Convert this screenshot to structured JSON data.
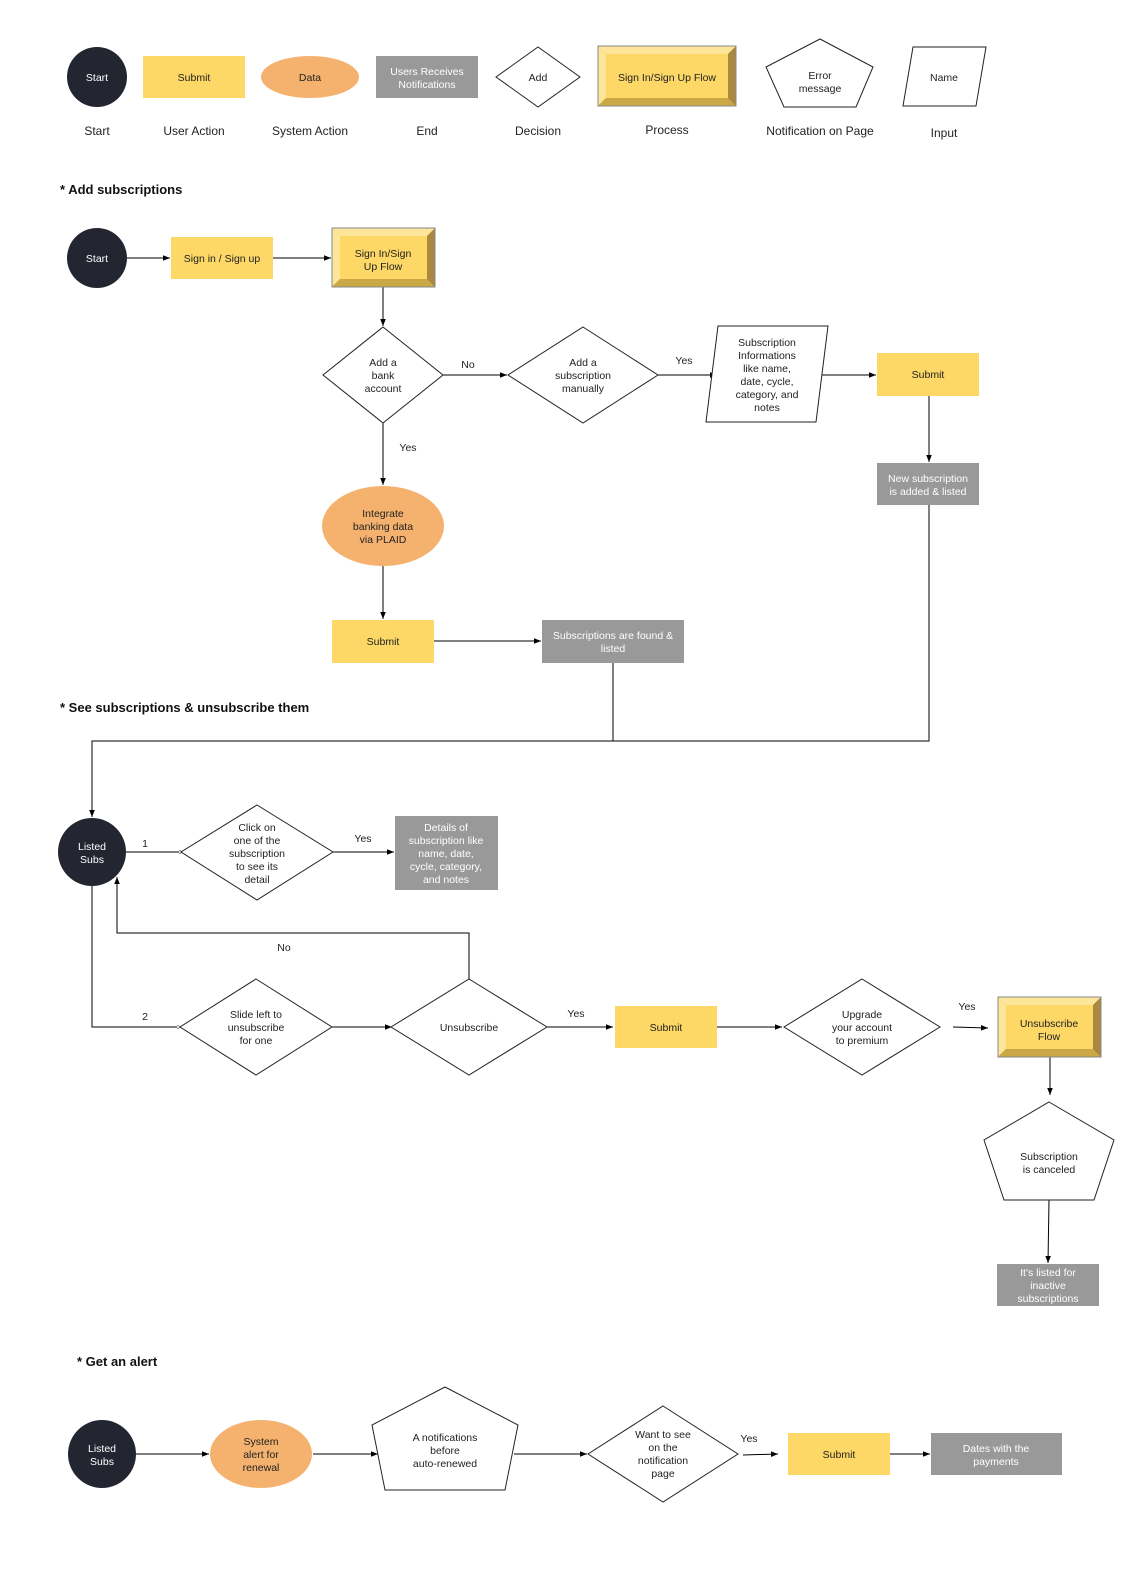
{
  "colors": {
    "start": "#232631",
    "user_action": "#fdd866",
    "system_action": "#f5b26e",
    "end": "#999999",
    "process": "#fdd866"
  },
  "legend": [
    {
      "shape": "Start",
      "label": "Start"
    },
    {
      "shape": "Submit",
      "label": "User Action"
    },
    {
      "shape": "Data",
      "label": "System Action"
    },
    {
      "shape": [
        "Users Receives",
        "Notifications"
      ],
      "label": "End"
    },
    {
      "shape": "Add",
      "label": "Decision"
    },
    {
      "shape": "Sign In/Sign Up Flow",
      "label": "Process"
    },
    {
      "shape": [
        "Error",
        "message"
      ],
      "label": "Notification on Page"
    },
    {
      "shape": "Name",
      "label": "Input"
    }
  ],
  "sections": {
    "add": {
      "title": "* Add subscriptions",
      "start": "Start",
      "sign_in": "Sign in / Sign up",
      "sign_flow": [
        "Sign In/Sign",
        "Up Flow"
      ],
      "bank": [
        "Add a",
        "bank",
        "account"
      ],
      "no": "No",
      "manual": [
        "Add a",
        "subscription",
        "manually"
      ],
      "yes1": "Yes",
      "info": [
        "Subscription",
        "Informations",
        "like name,",
        "date, cycle,",
        "category, and",
        "notes"
      ],
      "submit1": "Submit",
      "new_added": [
        "New subscription",
        "is added & listed"
      ],
      "yes2": "Yes",
      "plaid": [
        "Integrate",
        "banking data",
        "via PLAID"
      ],
      "submit2": "Submit",
      "found": [
        "Subscriptions are found &",
        "listed"
      ]
    },
    "see": {
      "title": "* See subscriptions & unsubscribe them",
      "listed": [
        "Listed",
        "Subs"
      ],
      "one": "1",
      "click": [
        "Click on",
        "one of the",
        "subscription",
        "to see its",
        "detail"
      ],
      "yes1": "Yes",
      "details": [
        "Details of",
        "subscription like",
        "name, date,",
        "cycle, category,",
        "and notes"
      ],
      "no": "No",
      "two": "2",
      "slide": [
        "Slide left to",
        "unsubscribe",
        "for one"
      ],
      "unsubscribe": "Unsubscribe",
      "yes2": "Yes",
      "submit": "Submit",
      "upgrade": [
        "Upgrade",
        "your account",
        "to premium"
      ],
      "yes3": "Yes",
      "unsub_flow": [
        "Unsubscribe",
        "Flow"
      ],
      "canceled": [
        "Subscription",
        "is canceled"
      ],
      "inactive": [
        "It's listed for",
        "inactive",
        "subscriptions"
      ]
    },
    "alert": {
      "title": "* Get an alert",
      "listed": [
        "Listed",
        "Subs"
      ],
      "system_alert": [
        "System",
        "alert for",
        "renewal"
      ],
      "notification": [
        "A notifications",
        "before",
        "auto-renewed"
      ],
      "want": [
        "Want to see",
        "on the",
        "notification",
        "page"
      ],
      "yes": "Yes",
      "submit": "Submit",
      "dates": [
        "Dates with the",
        "payments"
      ]
    }
  }
}
